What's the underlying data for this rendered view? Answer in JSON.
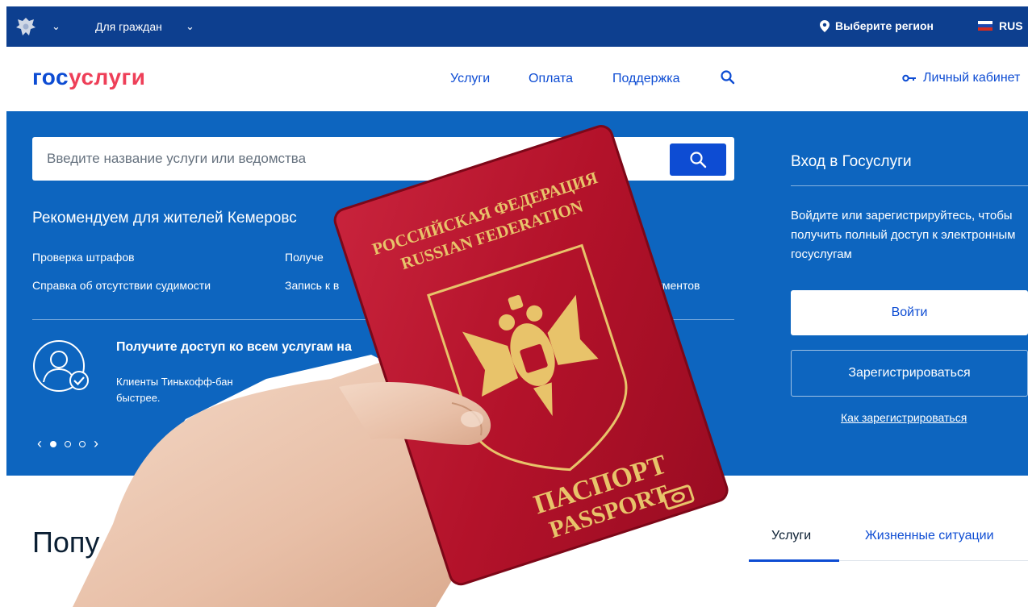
{
  "topbar": {
    "citizens_label": "Для граждан",
    "region_label": "Выберите регион",
    "language_label": "RUS"
  },
  "header": {
    "logo_part1": "гос",
    "logo_part2": "услуги",
    "nav": [
      {
        "label": "Услуги"
      },
      {
        "label": "Оплата"
      },
      {
        "label": "Поддержка"
      }
    ],
    "cabinet_label": "Личный кабинет"
  },
  "search": {
    "placeholder": "Введите название услуги или ведомства"
  },
  "recommend": {
    "title": "Рекомендуем для жителей Кемеровс",
    "links": [
      {
        "label": "Проверка штрафов"
      },
      {
        "label": "Получе"
      },
      {
        "label": "Справка об отсутствии судимости"
      },
      {
        "label": "Запись к в"
      },
      {
        "label": "ументов"
      }
    ]
  },
  "promo": {
    "title": "Получите доступ ко всем услугам на",
    "text_line1": "Клиенты Тинькофф-бан",
    "text_line2": "быстрее."
  },
  "carousel": {
    "prev": "‹",
    "next": "›"
  },
  "login": {
    "title": "Вход в Госуслуги",
    "description": "Войдите или зарегистрируйтесь, чтобы получить полный доступ к электронным госуслугам",
    "login_button": "Войти",
    "register_button": "Зарегистрироваться",
    "how_to_register": "Как зарегистрироваться"
  },
  "popular": {
    "title": "Попу"
  },
  "tabs": [
    {
      "label": "Услуги"
    },
    {
      "label": "Жизненные ситуации"
    }
  ],
  "passport": {
    "line1": "РОССИЙСКАЯ ФЕДЕРАЦИЯ",
    "line2": "RUSSIAN FEDERATION",
    "line3": "ПАСПОРТ",
    "line4": "PASSPORT"
  },
  "colors": {
    "topbar_bg": "#0d3f8f",
    "hero_bg": "#0d65bf",
    "brand_blue": "#0d4cd3",
    "brand_red": "#ee3f58",
    "passport_red": "#b3122a",
    "passport_gold": "#e8c36a"
  }
}
